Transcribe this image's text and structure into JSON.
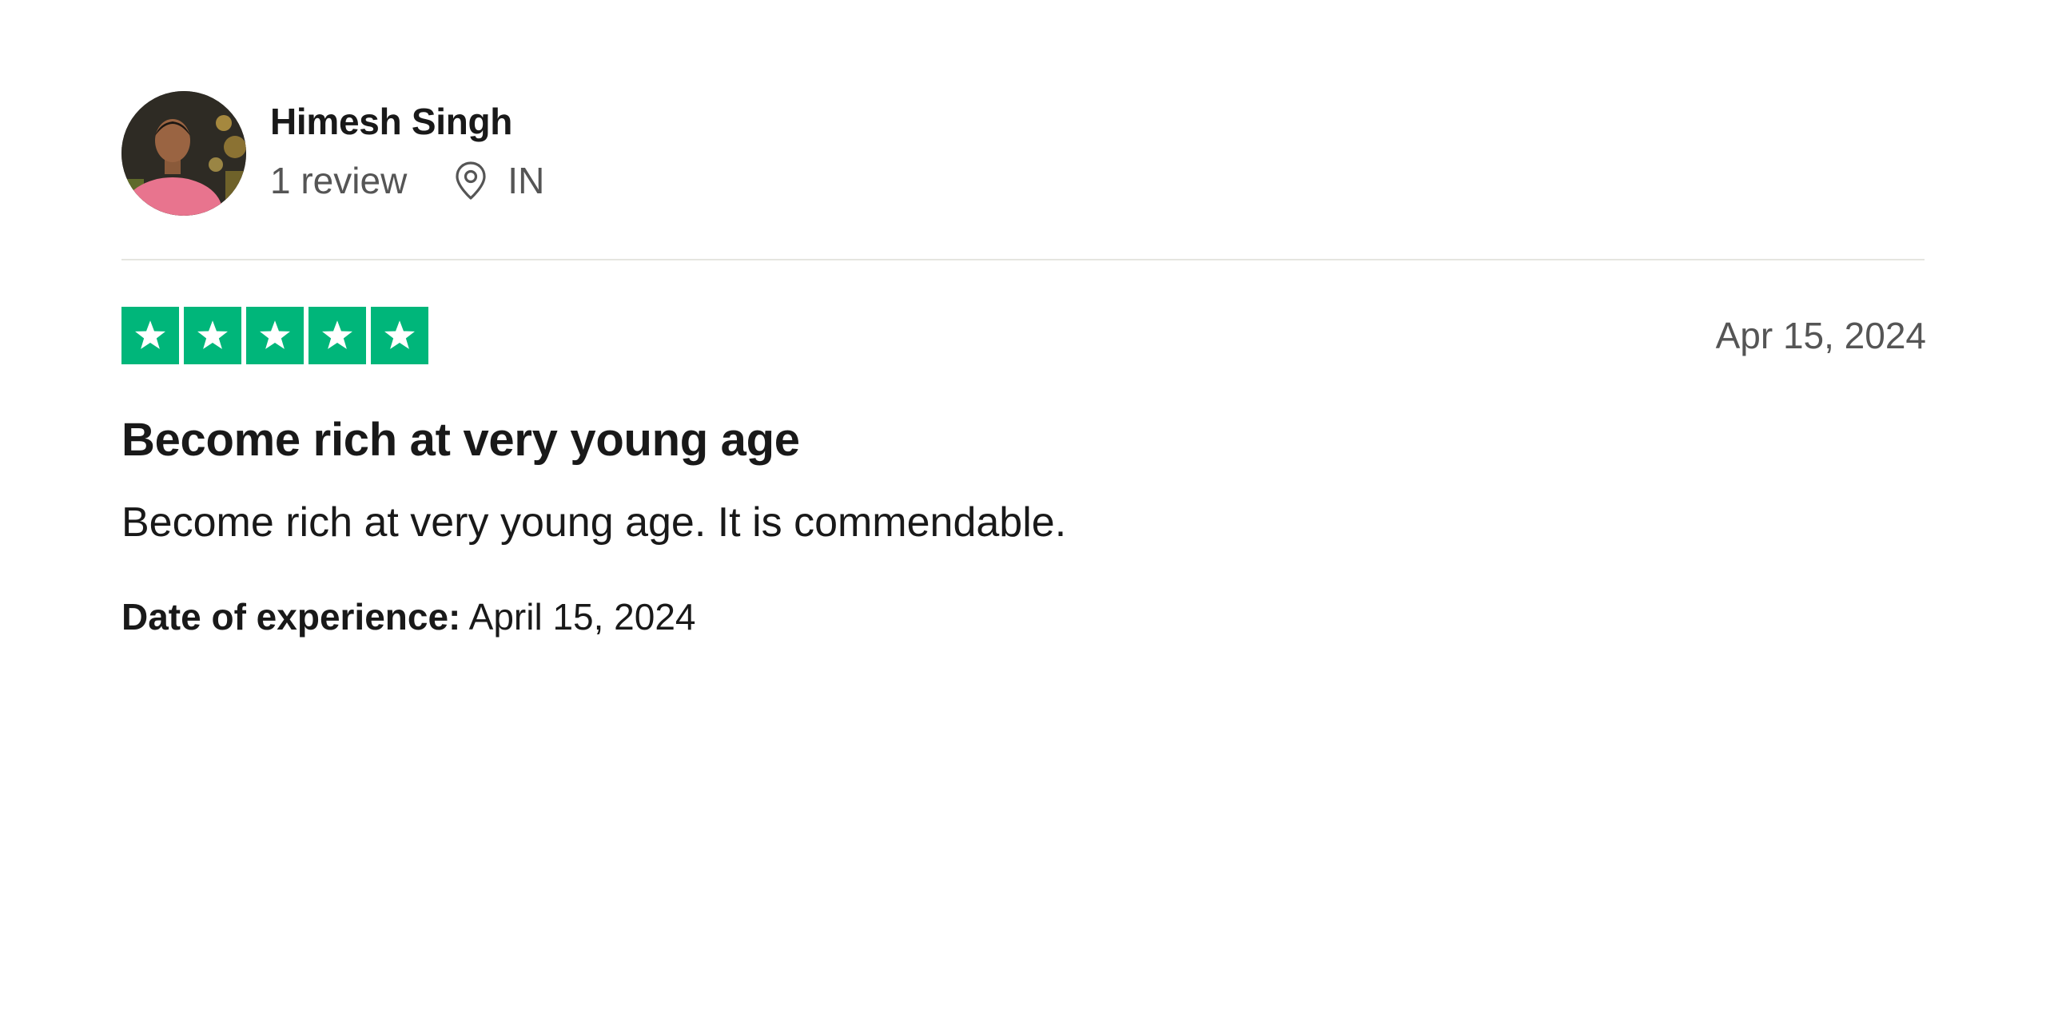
{
  "reviewer": {
    "name": "Himesh Singh",
    "review_count": "1 review",
    "country": "IN",
    "location_icon": "location-pin-icon"
  },
  "review": {
    "rating_stars": 5,
    "rating_max": 5,
    "star_color": "#00b67a",
    "date": "Apr 15, 2024",
    "title": "Become rich at very young age",
    "body": "Become rich at very young age. It is commendable.",
    "experience_label": "Date of experience:",
    "experience_date": "April 15, 2024"
  }
}
